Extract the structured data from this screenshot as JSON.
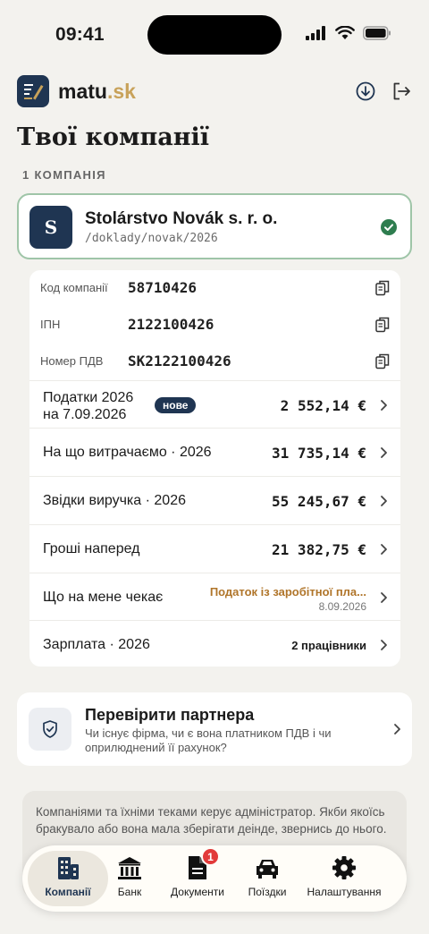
{
  "status_bar": {
    "time": "09:41"
  },
  "header": {
    "logo_name": "matu",
    "logo_tld": ".sk",
    "download_icon": "download-icon",
    "logout_icon": "logout-icon"
  },
  "page": {
    "title": "Твої компанії",
    "count_label": "1 КОМПАНІЯ"
  },
  "company": {
    "initial": "S",
    "name": "Stolárstvo Novák s. r. o.",
    "path": "/doklady/novak/2026"
  },
  "ids": [
    {
      "label": "Код компанії",
      "value": "58710426"
    },
    {
      "label": "ІПН",
      "value": "2122100426"
    },
    {
      "label": "Номер ПДВ",
      "value": "SK2122100426"
    }
  ],
  "rows": {
    "taxes": {
      "label_line1": "Податки 2026",
      "label_line2": "на 7.09.2026",
      "badge": "нове",
      "amount": "2 552,14 €"
    },
    "spending": {
      "label": "На що витрачаємо · 2026",
      "amount": "31 735,14 €"
    },
    "revenue": {
      "label": "Звідки виручка · 2026",
      "amount": "55 245,67 €"
    },
    "advance": {
      "label": "Гроші наперед",
      "amount": "21 382,75 €"
    },
    "pending": {
      "label": "Що на мене чекає",
      "note": "Податок із заробітної пла...",
      "date": "8.09.2026"
    },
    "salary": {
      "label": "Зарплата · 2026",
      "value": "2 працівники"
    }
  },
  "partner": {
    "title": "Перевірити партнера",
    "description": "Чи існує фірма, чи є вона платником ПДВ і чи оприлюднений її рахунок?"
  },
  "notice": {
    "text": "Компаніями та їхніми теками керує адміністратор. Якби якоїсь бракувало або вона мала зберігати деінде, звернись до нього."
  },
  "tabbar": {
    "tabs": [
      {
        "label": "Компанії",
        "icon": "building-icon",
        "active": true
      },
      {
        "label": "Банк",
        "icon": "bank-icon"
      },
      {
        "label": "Документи",
        "icon": "document-icon",
        "badge": "1"
      },
      {
        "label": "Поїздки",
        "icon": "car-icon"
      },
      {
        "label": "Налаштування",
        "icon": "gear-icon"
      }
    ]
  },
  "colors": {
    "background": "#f3f2ee",
    "brand_navy": "#1f3552",
    "accent_gold": "#c8a25a",
    "success_green": "#2e7d4f",
    "pending_orange": "#b0752a",
    "badge_red": "#e23a3a"
  }
}
